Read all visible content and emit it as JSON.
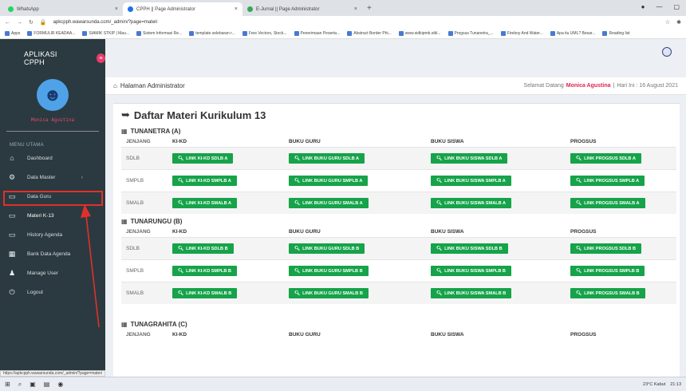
{
  "browser": {
    "tabs": [
      {
        "title": "WhatsApp",
        "color": "#25d366",
        "active": false
      },
      {
        "title": "CPPH || Page Administrator",
        "color": "#1a73e8",
        "active": true
      },
      {
        "title": "E-Jurnal || Page Administrator",
        "color": "#34a853",
        "active": false
      }
    ],
    "url": "apkcpph.wawarsunda.com/_admin/?page=materi",
    "bookmarks": [
      "Apps",
      "FORMULIR KEADAA...",
      "SIAMIK STKIP | Mau...",
      "Sistem Informasi Re...",
      "template selebaran r...",
      "Free Vectors, Stock...",
      "Penerimaan Peserta...",
      "Abstract Border Phi...",
      "www.sidkipmb.stkl...",
      "Progsus Tunanetra_...",
      "Fireboy And Water...",
      "Apa itu UML? Besar...",
      "Reading list"
    ]
  },
  "sidebar": {
    "brand": "APLIKASI CPPH",
    "user_name": "Monica Agustina",
    "menu_header": "MENU UTAMA",
    "items": [
      {
        "label": "Dashboard",
        "icon": "home-icon",
        "glyph": "⌂"
      },
      {
        "label": "Data Master",
        "icon": "cogs-icon",
        "glyph": "⚙"
      },
      {
        "label": "Data Guru",
        "icon": "folder-icon",
        "glyph": "▭"
      },
      {
        "label": "Materi K-13",
        "icon": "folder-icon",
        "glyph": "▭"
      },
      {
        "label": "History Agenda",
        "icon": "folder-icon",
        "glyph": "▭"
      },
      {
        "label": "Bank Data Agenda",
        "icon": "calendar-icon",
        "glyph": "▦"
      },
      {
        "label": "Manage User",
        "icon": "user-icon",
        "glyph": "♟"
      },
      {
        "label": "Logout",
        "icon": "power-icon",
        "glyph": "⏻"
      }
    ]
  },
  "header": {
    "breadcrumb": "Halaman Administrator",
    "welcome": "Selamat Datang",
    "user": "Monica Agustina",
    "date_label": "Hari Ini : 16 August 2021"
  },
  "page": {
    "title": "Daftar Materi Kurikulum 13",
    "columns": [
      "JENJANG",
      "KI-KD",
      "BUKU GURU",
      "BUKU SISWA",
      "PROGSUS"
    ],
    "sections": [
      {
        "title": "TUNANETRA (A)",
        "rows": [
          {
            "level": "SDLB",
            "links": [
              "LINK KI-KD SDLB A",
              "LINK BUKU GURU SDLB A",
              "LINK BUKU SISWA SDLB A",
              "LINK PROGSUS SDLB A"
            ]
          },
          {
            "level": "SMPLB",
            "links": [
              "LINK KI-KD SMPLB A",
              "LINK BUKU GURU SMPLB A",
              "LINK BUKU SISWA SMPLB A",
              "LINK PROGSUS SMPLB A"
            ]
          },
          {
            "level": "SMALB",
            "links": [
              "LINK KI-KD SMALB A",
              "LINK BUKU GURU SMALB A",
              "LINK BUKU SISWA SMALB A",
              "LINK PROGSUS SMALB A"
            ]
          }
        ]
      },
      {
        "title": "TUNARUNGU (B)",
        "rows": [
          {
            "level": "SDLB",
            "links": [
              "LINK KI-KD SDLB B",
              "LINK BUKU GURU SDLB B",
              "LINK BUKU SISWA SDLB B",
              "LINK PROGSUS SDLB B"
            ]
          },
          {
            "level": "SMPLB",
            "links": [
              "LINK KI-KD SMPLB B",
              "LINK BUKU GURU SMPLB B",
              "LINK BUKU SISWA SMPLB B",
              "LINK PROGSUS SMPLB B"
            ]
          },
          {
            "level": "SMALB",
            "links": [
              "LINK KI-KD SMALB B",
              "LINK BUKU GURU SMALB B",
              "LINK BUKU SISWA SMALB B",
              "LINK PROGSUS SMALB B"
            ]
          }
        ]
      },
      {
        "title": "TUNAGRAHITA (C)",
        "rows": []
      }
    ]
  },
  "statusbar": {
    "url": "https://apkcpph.wawarsunda.com/_admin/?page=materi"
  },
  "taskbar": {
    "weather": "23°C Kabut",
    "time": "21:13"
  }
}
